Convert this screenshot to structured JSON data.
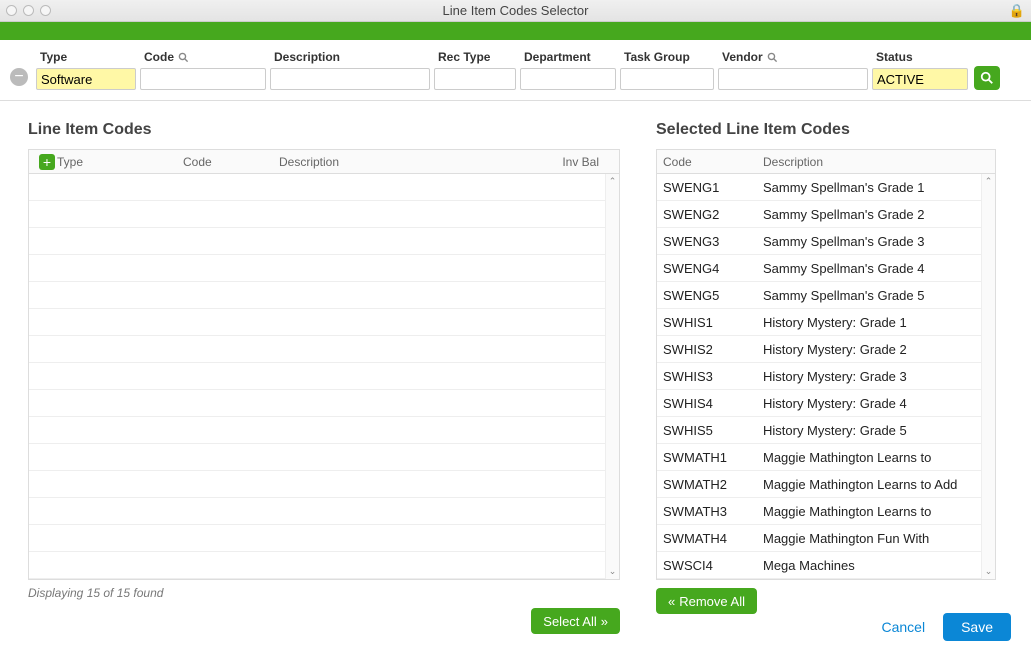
{
  "window": {
    "title": "Line Item Codes Selector"
  },
  "filters": {
    "labels": {
      "type": "Type",
      "code": "Code",
      "description": "Description",
      "recType": "Rec Type",
      "department": "Department",
      "taskGroup": "Task Group",
      "vendor": "Vendor",
      "status": "Status"
    },
    "values": {
      "type": "Software",
      "code": "",
      "description": "",
      "recType": "",
      "department": "",
      "taskGroup": "",
      "vendor": "",
      "status": "ACTIVE"
    }
  },
  "leftPanel": {
    "title": "Line Item Codes",
    "headers": {
      "type": "Type",
      "code": "Code",
      "description": "Description",
      "invBal": "Inv Bal"
    },
    "status": "Displaying 15 of 15 found",
    "selectAll": "Select All",
    "emptyRows": 15
  },
  "rightPanel": {
    "title": "Selected Line Item Codes",
    "headers": {
      "code": "Code",
      "description": "Description"
    },
    "removeAll": "Remove All",
    "rows": [
      {
        "code": "SWENG1",
        "description": "Sammy Spellman's Grade 1"
      },
      {
        "code": "SWENG2",
        "description": "Sammy Spellman's Grade 2"
      },
      {
        "code": "SWENG3",
        "description": "Sammy Spellman's Grade 3"
      },
      {
        "code": "SWENG4",
        "description": "Sammy Spellman's Grade 4"
      },
      {
        "code": "SWENG5",
        "description": "Sammy Spellman's Grade 5"
      },
      {
        "code": "SWHIS1",
        "description": "History Mystery: Grade 1"
      },
      {
        "code": "SWHIS2",
        "description": "History Mystery: Grade 2"
      },
      {
        "code": "SWHIS3",
        "description": "History Mystery: Grade 3"
      },
      {
        "code": "SWHIS4",
        "description": "History Mystery: Grade 4"
      },
      {
        "code": "SWHIS5",
        "description": "History Mystery: Grade 5"
      },
      {
        "code": "SWMATH1",
        "description": "Maggie Mathington Learns to"
      },
      {
        "code": "SWMATH2",
        "description": "Maggie Mathington Learns to Add"
      },
      {
        "code": "SWMATH3",
        "description": "Maggie Mathington Learns to"
      },
      {
        "code": "SWMATH4",
        "description": "Maggie Mathington Fun With"
      },
      {
        "code": "SWSCI4",
        "description": "Mega Machines"
      }
    ]
  },
  "footer": {
    "cancel": "Cancel",
    "save": "Save"
  }
}
